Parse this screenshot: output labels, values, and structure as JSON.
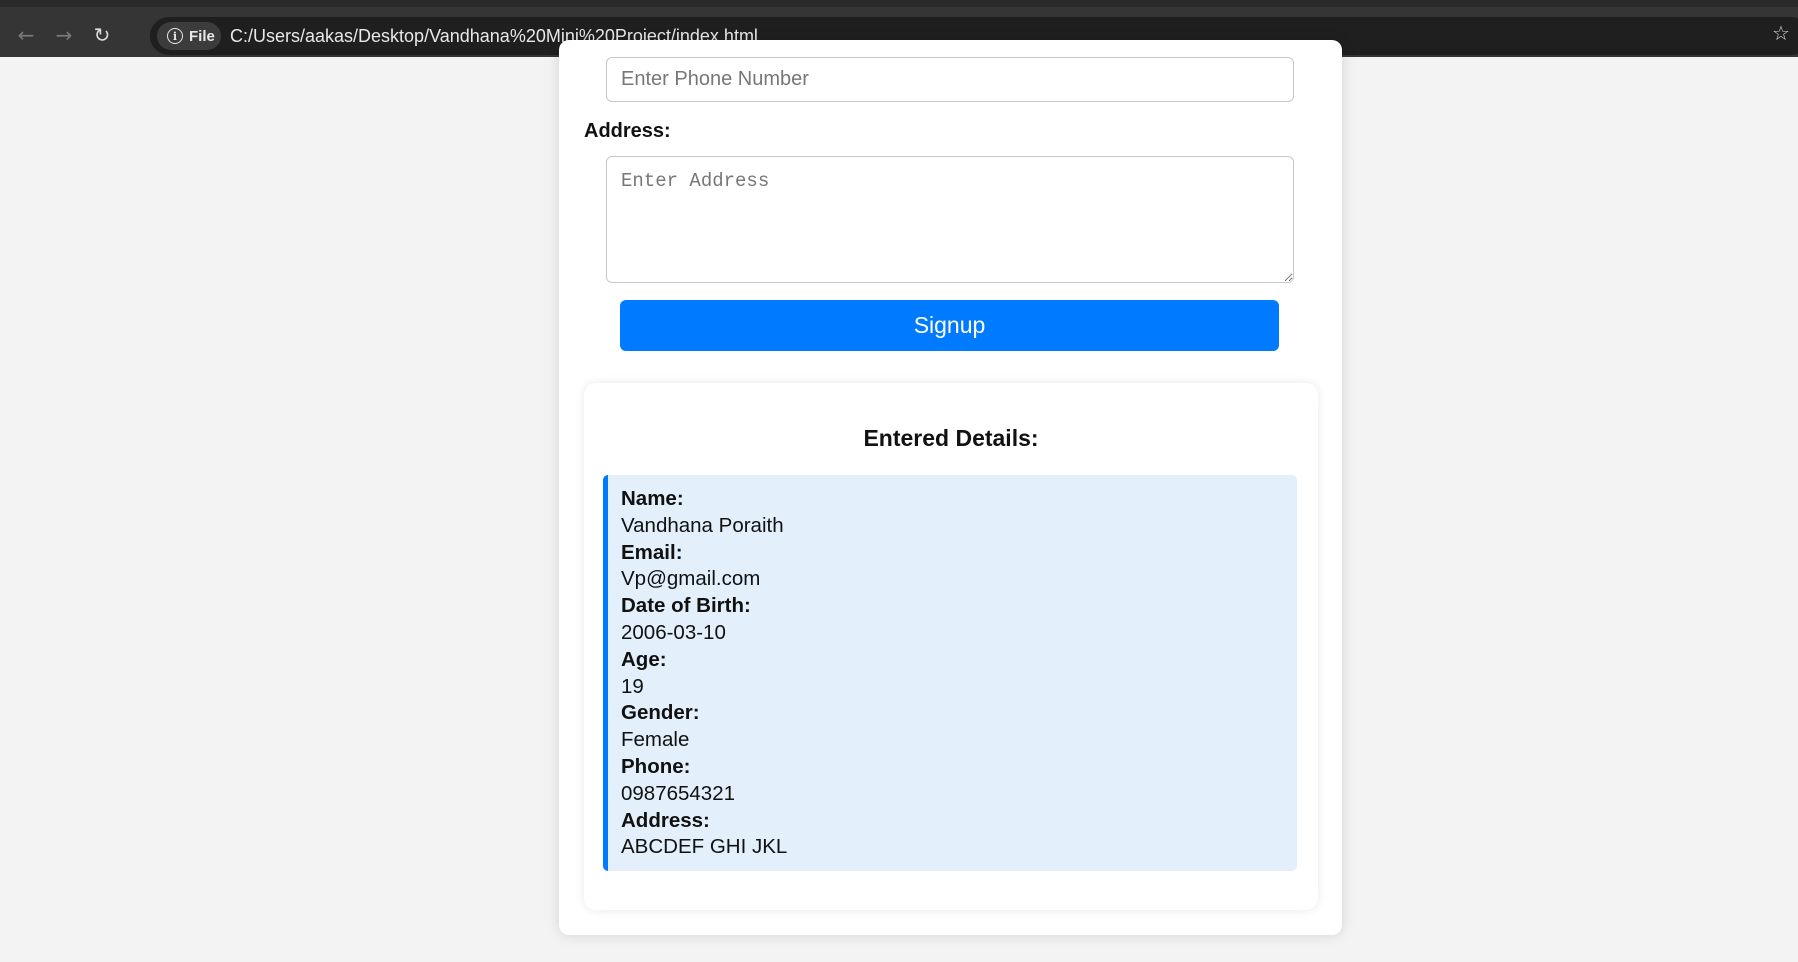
{
  "browser": {
    "site_chip_label": "File",
    "url": "C:/Users/aakas/Desktop/Vandhana%20Mini%20Project/index.html",
    "back_glyph": "←",
    "forward_glyph": "→",
    "reload_glyph": "↻",
    "info_glyph": "i",
    "star_glyph": "☆"
  },
  "form": {
    "phone_placeholder": "Enter Phone Number",
    "address_label": "Address:",
    "address_placeholder": "Enter Address",
    "signup_label": "Signup"
  },
  "details": {
    "title": "Entered Details:",
    "items": [
      {
        "label": "Name:",
        "value": "Vandhana Poraith"
      },
      {
        "label": "Email:",
        "value": "Vp@gmail.com"
      },
      {
        "label": "Date of Birth:",
        "value": "2006-03-10"
      },
      {
        "label": "Age:",
        "value": "19"
      },
      {
        "label": "Gender:",
        "value": "Female"
      },
      {
        "label": "Phone:",
        "value": "0987654321"
      },
      {
        "label": "Address:",
        "value": "ABCDEF GHI JKL"
      }
    ]
  },
  "colors": {
    "accent": "#007bff",
    "details_background": "#e3f0fb",
    "page_background": "#f3f3f3"
  }
}
